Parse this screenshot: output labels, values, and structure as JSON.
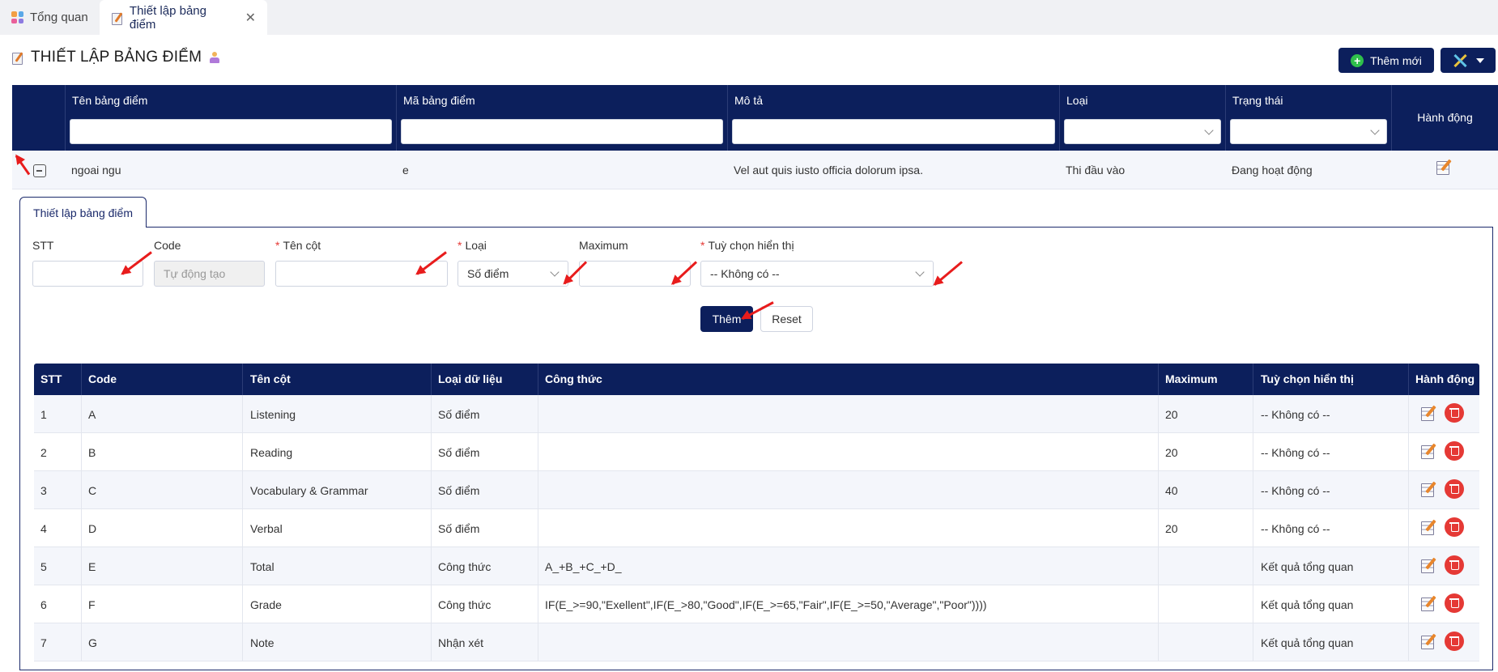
{
  "tabs": [
    {
      "label": "Tổng quan",
      "icon": "dashboard-icon",
      "active": false
    },
    {
      "label": "Thiết lập bảng điểm",
      "icon": "memo-icon",
      "active": true
    }
  ],
  "page": {
    "title": "THIẾT LẬP BẢNG ĐIỂM"
  },
  "toolbar": {
    "add_label": "Thêm mới"
  },
  "main_table": {
    "columns": [
      "Tên bảng điểm",
      "Mã bảng điểm",
      "Mô tả",
      "Loại",
      "Trạng thái",
      "Hành động"
    ],
    "row": {
      "name": "ngoai ngu",
      "code": "e",
      "description": "Vel aut quis iusto officia dolorum ipsa.",
      "type": "Thi đầu vào",
      "status": "Đang hoạt động"
    }
  },
  "detail": {
    "tab_label": "Thiết lập bảng điểm",
    "form": {
      "stt_label": "STT",
      "code_label": "Code",
      "code_placeholder": "Tự động tạo",
      "name_label": "Tên cột",
      "type_label": "Loại",
      "type_value": "Số điểm",
      "max_label": "Maximum",
      "display_label": "Tuỳ chọn hiển thị",
      "display_value": "-- Không có --",
      "required_mark": "*"
    },
    "add_label": "Thêm",
    "reset_label": "Reset",
    "table": {
      "columns": [
        "STT",
        "Code",
        "Tên cột",
        "Loại dữ liệu",
        "Công thức",
        "Maximum",
        "Tuỳ chọn hiển thị",
        "Hành động"
      ],
      "rows": [
        {
          "stt": "1",
          "code": "A",
          "name": "Listening",
          "type": "Số điểm",
          "formula": "",
          "max": "20",
          "display": "-- Không có --"
        },
        {
          "stt": "2",
          "code": "B",
          "name": "Reading",
          "type": "Số điểm",
          "formula": "",
          "max": "20",
          "display": "-- Không có --"
        },
        {
          "stt": "3",
          "code": "C",
          "name": "Vocabulary & Grammar",
          "type": "Số điểm",
          "formula": "",
          "max": "40",
          "display": "-- Không có --"
        },
        {
          "stt": "4",
          "code": "D",
          "name": "Verbal",
          "type": "Số điểm",
          "formula": "",
          "max": "20",
          "display": "-- Không có --"
        },
        {
          "stt": "5",
          "code": "E",
          "name": "Total",
          "type": "Công thức",
          "formula": "A_+B_+C_+D_",
          "max": "",
          "display": "Kết quả tổng quan"
        },
        {
          "stt": "6",
          "code": "F",
          "name": "Grade",
          "type": "Công thức",
          "formula": "IF(E_>=90,\"Exellent\",IF(E_>80,\"Good\",IF(E_>=65,\"Fair\",IF(E_>=50,\"Average\",\"Poor\"))))",
          "max": "",
          "display": "Kết quả tổng quan"
        },
        {
          "stt": "7",
          "code": "G",
          "name": "Note",
          "type": "Nhận xét",
          "formula": "",
          "max": "",
          "display": "Kết quả tổng quan"
        }
      ]
    }
  },
  "colors": {
    "primary": "#0c1f5c",
    "annotation": "#e81c1c",
    "delete": "#e53935",
    "add_icon": "#2fbf4b"
  }
}
